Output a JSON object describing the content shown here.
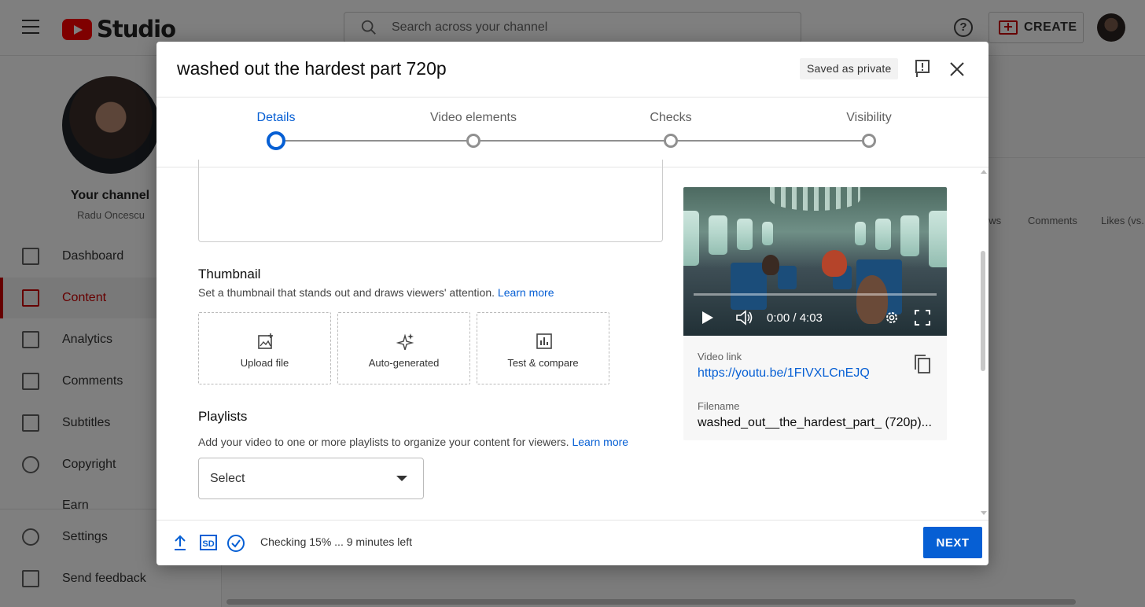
{
  "app": {
    "logo_text": "Studio",
    "search_placeholder": "Search across your channel",
    "create_label": "CREATE"
  },
  "sidebar": {
    "channel_title": "Your channel",
    "channel_name": "Radu Oncescu",
    "items": [
      {
        "label": "Dashboard",
        "icon": "dashboard-icon"
      },
      {
        "label": "Content",
        "icon": "content-icon",
        "active": true
      },
      {
        "label": "Analytics",
        "icon": "analytics-icon"
      },
      {
        "label": "Comments",
        "icon": "comments-icon"
      },
      {
        "label": "Subtitles",
        "icon": "subtitles-icon"
      },
      {
        "label": "Copyright",
        "icon": "copyright-icon"
      },
      {
        "label": "Earn",
        "icon": "earn-icon"
      }
    ],
    "bottom_items": [
      {
        "label": "Settings",
        "icon": "gear-icon"
      },
      {
        "label": "Send feedback",
        "icon": "feedback-icon"
      }
    ]
  },
  "background_table": {
    "columns": [
      "ews",
      "Comments",
      "Likes (vs."
    ]
  },
  "dialog": {
    "title": "washed out the hardest part 720p",
    "saved_badge": "Saved as private",
    "steps": [
      {
        "label": "Details",
        "active": true
      },
      {
        "label": "Video elements"
      },
      {
        "label": "Checks"
      },
      {
        "label": "Visibility"
      }
    ],
    "thumbnail": {
      "title": "Thumbnail",
      "description": "Set a thumbnail that stands out and draws viewers' attention.",
      "learn_more": "Learn more",
      "options": [
        {
          "label": "Upload file",
          "icon": "upload-image-icon"
        },
        {
          "label": "Auto-generated",
          "icon": "sparkle-icon"
        },
        {
          "label": "Test & compare",
          "icon": "bar-chart-icon"
        }
      ]
    },
    "playlists": {
      "title": "Playlists",
      "description": "Add your video to one or more playlists to organize your content for viewers.",
      "learn_more": "Learn more",
      "select_value": "Select"
    },
    "preview": {
      "time": "0:00 / 4:03",
      "video_link_label": "Video link",
      "video_link": "https://youtu.be/1FIVXLCnEJQ",
      "filename_label": "Filename",
      "filename": "washed_out__the_hardest_part_ (720p)..."
    },
    "footer": {
      "status": "Checking 15% ... 9 minutes left",
      "next_label": "NEXT",
      "sd_badge": "SD"
    }
  },
  "colors": {
    "accent_blue": "#065fd4",
    "brand_red": "#ff0000",
    "active_nav_red": "#cc0000"
  }
}
